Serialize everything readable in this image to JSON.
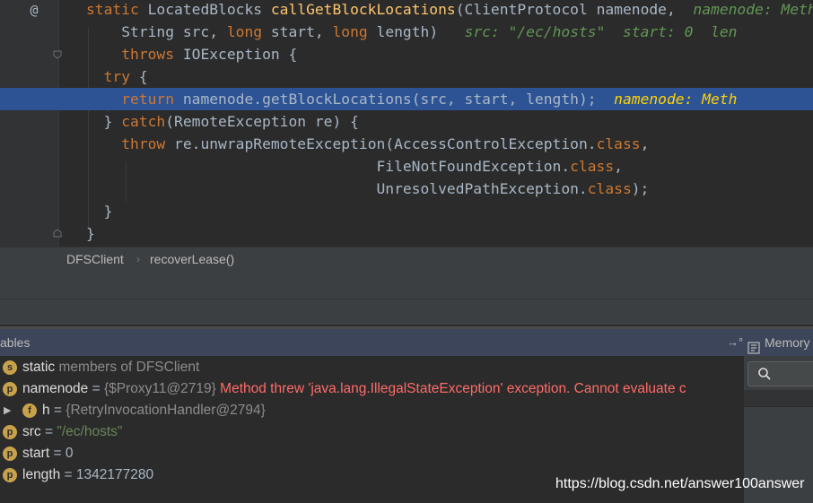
{
  "code": {
    "lines": [
      {
        "parts": [
          {
            "t": "static ",
            "c": "kw"
          },
          {
            "t": "LocatedBlocks ",
            "c": "plain"
          },
          {
            "t": "callGetBlockLocations",
            "c": "fn"
          },
          {
            "t": "(ClientProtocol ",
            "c": "plain"
          },
          {
            "t": "namenode",
            "c": "prm"
          },
          {
            "t": ",  ",
            "c": "plain"
          },
          {
            "t": "namenode: Metho",
            "c": "hint"
          }
        ]
      },
      {
        "parts": [
          {
            "t": "    String ",
            "c": "plain"
          },
          {
            "t": "src",
            "c": "prm"
          },
          {
            "t": ", ",
            "c": "plain"
          },
          {
            "t": "long ",
            "c": "kw"
          },
          {
            "t": "start",
            "c": "prm"
          },
          {
            "t": ", ",
            "c": "plain"
          },
          {
            "t": "long ",
            "c": "kw"
          },
          {
            "t": "length",
            "c": "prm"
          },
          {
            "t": ")   ",
            "c": "plain"
          },
          {
            "t": "src: \"/ec/hosts\"  start: 0  len",
            "c": "hint"
          }
        ]
      },
      {
        "parts": [
          {
            "t": "    ",
            "c": "plain"
          },
          {
            "t": "throws ",
            "c": "kw"
          },
          {
            "t": "IOException {",
            "c": "plain"
          }
        ]
      },
      {
        "parts": [
          {
            "t": "  ",
            "c": "plain"
          },
          {
            "t": "try ",
            "c": "kw"
          },
          {
            "t": "{",
            "c": "plain"
          }
        ]
      },
      {
        "parts": [
          {
            "t": "    ",
            "c": "plain"
          },
          {
            "t": "return ",
            "c": "kw"
          },
          {
            "t": "namenode.getBlockLocations(src, start, length);  ",
            "c": "plain"
          },
          {
            "t": "namenode: Meth",
            "c": "hint-y"
          }
        ]
      },
      {
        "parts": [
          {
            "t": "  } ",
            "c": "plain"
          },
          {
            "t": "catch",
            "c": "kw"
          },
          {
            "t": "(RemoteException re) {",
            "c": "plain"
          }
        ]
      },
      {
        "parts": [
          {
            "t": "    ",
            "c": "plain"
          },
          {
            "t": "throw ",
            "c": "kw"
          },
          {
            "t": "re.unwrapRemoteException(AccessControlException.",
            "c": "plain"
          },
          {
            "t": "class",
            "c": "kw"
          },
          {
            "t": ",",
            "c": "plain"
          }
        ]
      },
      {
        "parts": [
          {
            "t": "                                 FileNotFoundException.",
            "c": "plain"
          },
          {
            "t": "class",
            "c": "kw"
          },
          {
            "t": ",",
            "c": "plain"
          }
        ]
      },
      {
        "parts": [
          {
            "t": "                                 UnresolvedPathException.",
            "c": "plain"
          },
          {
            "t": "class",
            "c": "kw"
          },
          {
            "t": ");",
            "c": "plain"
          }
        ]
      },
      {
        "parts": [
          {
            "t": "  }",
            "c": "plain"
          }
        ]
      },
      {
        "parts": [
          {
            "t": "}",
            "c": "plain"
          }
        ]
      }
    ],
    "gutter_at": "@"
  },
  "breadcrumb": {
    "items": [
      "DFSClient",
      "recoverLease()"
    ],
    "separator": "›"
  },
  "debug": {
    "variables_title": "ables",
    "memory_title": "Memory",
    "pin_glyph": "→°",
    "variables": [
      {
        "badge": "s",
        "name": "static",
        "rest": " members of DFSClient",
        "restClass": "vgray",
        "expander": ""
      },
      {
        "badge": "p",
        "name": "namenode",
        "eq": " = ",
        "ref": "{$Proxy11@2719} ",
        "err": "Method threw 'java.lang.IllegalStateException' exception. Cannot evaluate c",
        "expander": ""
      },
      {
        "badge": "f",
        "name": "h",
        "eq": " = ",
        "ref": "{RetryInvocationHandler@2794}",
        "expander": "▶"
      },
      {
        "badge": "p",
        "name": "src",
        "eq": " = ",
        "str": "\"/ec/hosts\"",
        "expander": ""
      },
      {
        "badge": "p",
        "name": "start",
        "eq": " = ",
        "num": "0",
        "expander": ""
      },
      {
        "badge": "p",
        "name": "length",
        "eq": " = ",
        "num": "1342177280",
        "expander": ""
      }
    ]
  },
  "watermark": "https://blog.csdn.net/answer100answer",
  "icons": {
    "gutter": "at-icon",
    "breakpoint": "breakpoint-check-icon",
    "fold": "fold-icon",
    "search": "search-icon",
    "memory": "memory-icon",
    "pin": "pin-icon"
  },
  "colors": {
    "highlight": "#2d5395",
    "keyword": "#cc7832",
    "method": "#ffc66d",
    "hint": "#629755",
    "error": "#ff6b68",
    "badge": "#c8a24a"
  }
}
